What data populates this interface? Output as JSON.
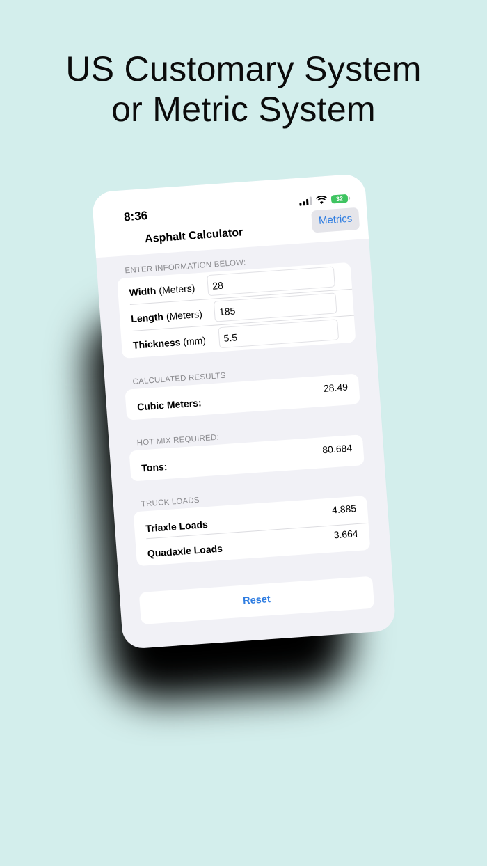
{
  "headline": {
    "line1": "US Customary System",
    "line2": "or Metric System"
  },
  "status_bar": {
    "time": "8:36",
    "battery": "32",
    "icons": [
      "cellular-signal-icon",
      "wifi-icon",
      "battery-icon"
    ]
  },
  "nav": {
    "title": "Asphalt Calculator",
    "metrics_button": "Metrics"
  },
  "input_section": {
    "header": "ENTER INFORMATION BELOW:",
    "fields": [
      {
        "label": "Width",
        "unit": "(Meters)",
        "value": "28"
      },
      {
        "label": "Length",
        "unit": "(Meters)",
        "value": "185"
      },
      {
        "label": "Thickness",
        "unit": "(mm)",
        "value": "5.5"
      }
    ]
  },
  "calculated_section": {
    "header": "CALCULATED RESULTS",
    "label": "Cubic Meters:",
    "value": "28.49"
  },
  "hotmix_section": {
    "header": "HOT MIX REQUIRED:",
    "label": "Tons:",
    "value": "80.684"
  },
  "truck_section": {
    "header": "TRUCK LOADS",
    "rows": [
      {
        "label": "Triaxle Loads",
        "value": "4.885"
      },
      {
        "label": "Quadaxle Loads",
        "value": "3.664"
      }
    ]
  },
  "reset_button": "Reset",
  "colors": {
    "background": "#d3eeec",
    "accent": "#2f7de1",
    "battery": "#3fc461",
    "screen_bg": "#f1f1f6"
  }
}
